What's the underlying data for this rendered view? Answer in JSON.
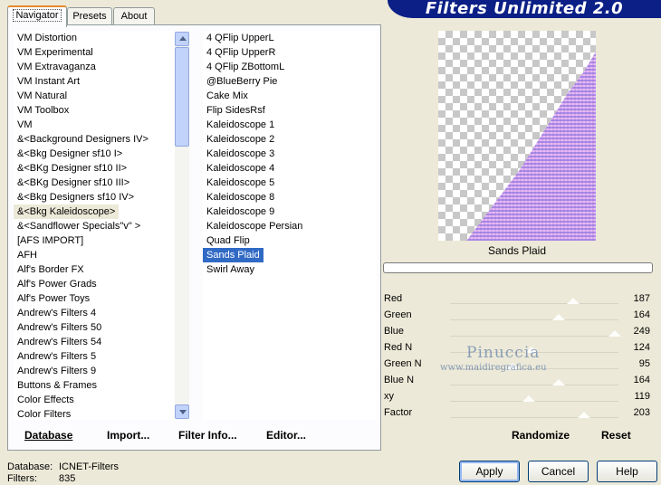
{
  "banner": {
    "title": "Filters Unlimited 2.0"
  },
  "tabs": [
    {
      "label": "Navigator",
      "active": true
    },
    {
      "label": "Presets",
      "active": false
    },
    {
      "label": "About",
      "active": false
    }
  ],
  "categories": {
    "items": [
      "VM Distortion",
      "VM Experimental",
      "VM Extravaganza",
      "VM Instant Art",
      "VM Natural",
      "VM Toolbox",
      "VM",
      "&<Background Designers IV>",
      "&<Bkg Designer sf10 I>",
      "&<BKg Designer sf10 II>",
      "&<BKg Designer sf10 III>",
      "&<Bkg Designers sf10 IV>",
      "&<Bkg Kaleidoscope>",
      "&<Sandflower Specials\"v\" >",
      "[AFS IMPORT]",
      "AFH",
      "Alf's Border FX",
      "Alf's Power Grads",
      "Alf's Power Toys",
      "Andrew's Filters 4",
      "Andrew's Filters 50",
      "Andrew's Filters 54",
      "Andrew's Filters 5",
      "Andrew's Filters 9",
      "Buttons & Frames",
      "Color Effects",
      "Color Filters"
    ],
    "selected": "&<Bkg Kaleidoscope>"
  },
  "filters": {
    "items": [
      "4 QFlip UpperL",
      "4 QFlip UpperR",
      "4 QFlip ZBottomL",
      "@BlueBerry Pie",
      "Cake Mix",
      "Flip SidesRsf",
      "Kaleidoscope 1",
      "Kaleidoscope 2",
      "Kaleidoscope 3",
      "Kaleidoscope 4",
      "Kaleidoscope 5",
      "Kaleidoscope 8",
      "Kaleidoscope 9",
      "Kaleidoscope Persian",
      "Quad Flip",
      "Sands Plaid",
      "Swirl Away"
    ],
    "selected": "Sands Plaid"
  },
  "toolbar": {
    "database": "Database",
    "import": "Import...",
    "filter_info": "Filter Info...",
    "editor": "Editor..."
  },
  "preview": {
    "filter_name": "Sands Plaid",
    "progress": 0
  },
  "params": [
    {
      "name": "Red",
      "value": "187",
      "v": 187
    },
    {
      "name": "Green",
      "value": "164",
      "v": 164
    },
    {
      "name": "Blue",
      "value": "249",
      "v": 249
    },
    {
      "name": "Red N",
      "value": "124",
      "v": 124
    },
    {
      "name": "Green N",
      "value": "95",
      "v": 95
    },
    {
      "name": "Blue N",
      "value": "164",
      "v": 164
    },
    {
      "name": "xy",
      "value": "119",
      "v": 119
    },
    {
      "name": "Factor",
      "value": "203",
      "v": 203
    }
  ],
  "param_buttons": {
    "randomize": "Randomize",
    "reset": "Reset"
  },
  "watermark": {
    "line1": "Pinuccia",
    "line2": "www.maidiregrafica.eu"
  },
  "footer": {
    "database_label": "Database:",
    "database_value": "ICNET-Filters",
    "filters_label": "Filters:",
    "filters_value": "835"
  },
  "buttons": {
    "apply": "Apply",
    "cancel": "Cancel",
    "help": "Help"
  },
  "colors": {
    "banner": "#0b1f86",
    "selection": "#316ac5",
    "tab_accent": "#e68b2c"
  }
}
